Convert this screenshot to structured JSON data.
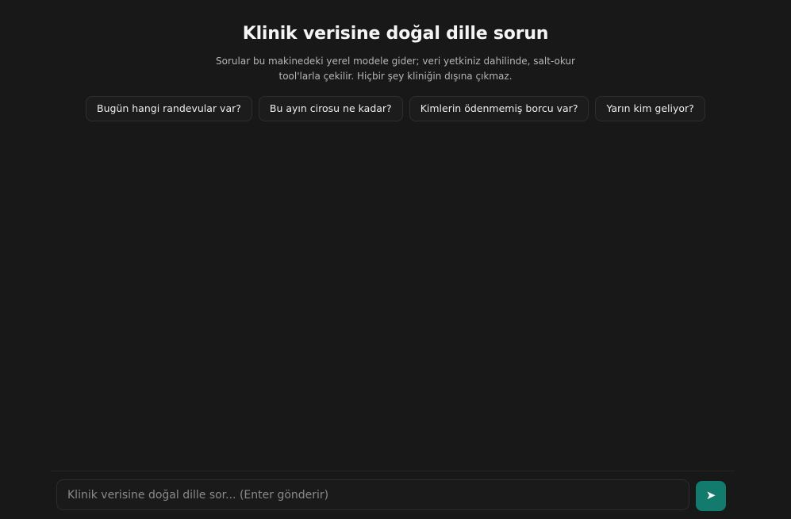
{
  "header": {
    "title": "Klinik verisine doğal dille sorun",
    "subtitle": "Sorular bu makinedeki yerel modele gider; veri yetkiniz dahilinde, salt-okur tool'larla çekilir. Hiçbir şey kliniğin dışına çıkmaz."
  },
  "suggestions": [
    {
      "label": "Bugün hangi randevular var?"
    },
    {
      "label": "Bu ayın cirosu ne kadar?"
    },
    {
      "label": "Kimlerin ödenmemiş borcu var?"
    },
    {
      "label": "Yarın kim geliyor?"
    }
  ],
  "composer": {
    "placeholder": "Klinik verisine doğal dille sor... (Enter gönderir)",
    "value": "",
    "send_icon": "send-arrow-icon",
    "send_glyph": "➤",
    "accent_color": "#137a6e"
  }
}
